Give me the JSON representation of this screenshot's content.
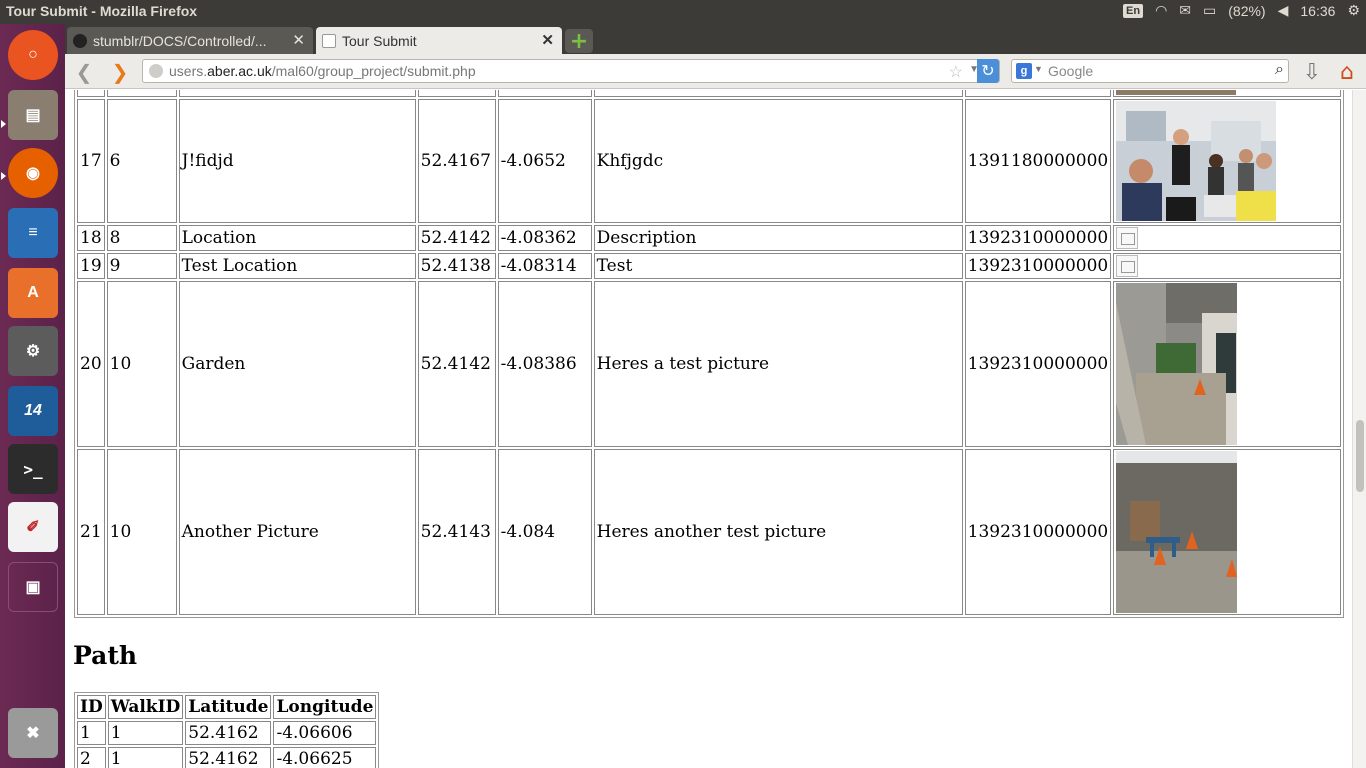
{
  "window": {
    "title": "Tour Submit - Mozilla Firefox"
  },
  "indicators": {
    "keyboard": "En",
    "battery": "(82%)",
    "time": "16:36"
  },
  "tabs": [
    {
      "label": "stumblr/DOCS/Controlled/...",
      "icon": "github-icon"
    },
    {
      "label": "Tour Submit",
      "icon": "page-icon"
    }
  ],
  "url": {
    "prefix": "users.",
    "host": "aber.ac.uk",
    "path": "/mal60/group_project/submit.php"
  },
  "search": {
    "placeholder": "Google"
  },
  "locations": {
    "rows": [
      {
        "id": "17",
        "walk": "6",
        "name": "J!fidjd",
        "lat": "52.4167",
        "lng": "-4.0652",
        "desc": "Khfjgdc",
        "ts": "1391180000000",
        "img": "group"
      },
      {
        "id": "18",
        "walk": "8",
        "name": "Location",
        "lat": "52.4142",
        "lng": "-4.08362",
        "desc": "Description",
        "ts": "1392310000000",
        "img": "broken"
      },
      {
        "id": "19",
        "walk": "9",
        "name": "Test Location",
        "lat": "52.4138",
        "lng": "-4.08314",
        "desc": "Test",
        "ts": "1392310000000",
        "img": "broken"
      },
      {
        "id": "20",
        "walk": "10",
        "name": "Garden",
        "lat": "52.4142",
        "lng": "-4.08386",
        "desc": "Heres a test picture",
        "ts": "1392310000000",
        "img": "garden"
      },
      {
        "id": "21",
        "walk": "10",
        "name": "Another Picture",
        "lat": "52.4143",
        "lng": "-4.084",
        "desc": "Heres another test picture",
        "ts": "1392310000000",
        "img": "wall"
      }
    ]
  },
  "path": {
    "title": "Path",
    "headers": [
      "ID",
      "WalkID",
      "Latitude",
      "Longitude"
    ],
    "rows": [
      [
        "1",
        "1",
        "52.4162",
        "-4.06606"
      ],
      [
        "2",
        "1",
        "52.4162",
        "-4.06625"
      ]
    ]
  },
  "launcher": [
    {
      "name": "ubuntu-icon",
      "bg": "#e95420"
    },
    {
      "name": "files-icon",
      "bg": "#7a6e62"
    },
    {
      "name": "firefox-icon",
      "bg": "#e66000"
    },
    {
      "name": "writer-icon",
      "bg": "#2a6fb5"
    },
    {
      "name": "software-center-icon",
      "bg": "#e9702a"
    },
    {
      "name": "settings-icon",
      "bg": "#5c5c5c"
    },
    {
      "name": "ide-icon",
      "bg": "#1f5c9a"
    },
    {
      "name": "terminal-icon",
      "bg": "#2c2c2c"
    },
    {
      "name": "reader-icon",
      "bg": "#f2f2f2"
    },
    {
      "name": "workspace-icon",
      "bg": "#6b3a5c"
    },
    {
      "name": "trash-icon",
      "bg": "#8b8b8b"
    }
  ]
}
